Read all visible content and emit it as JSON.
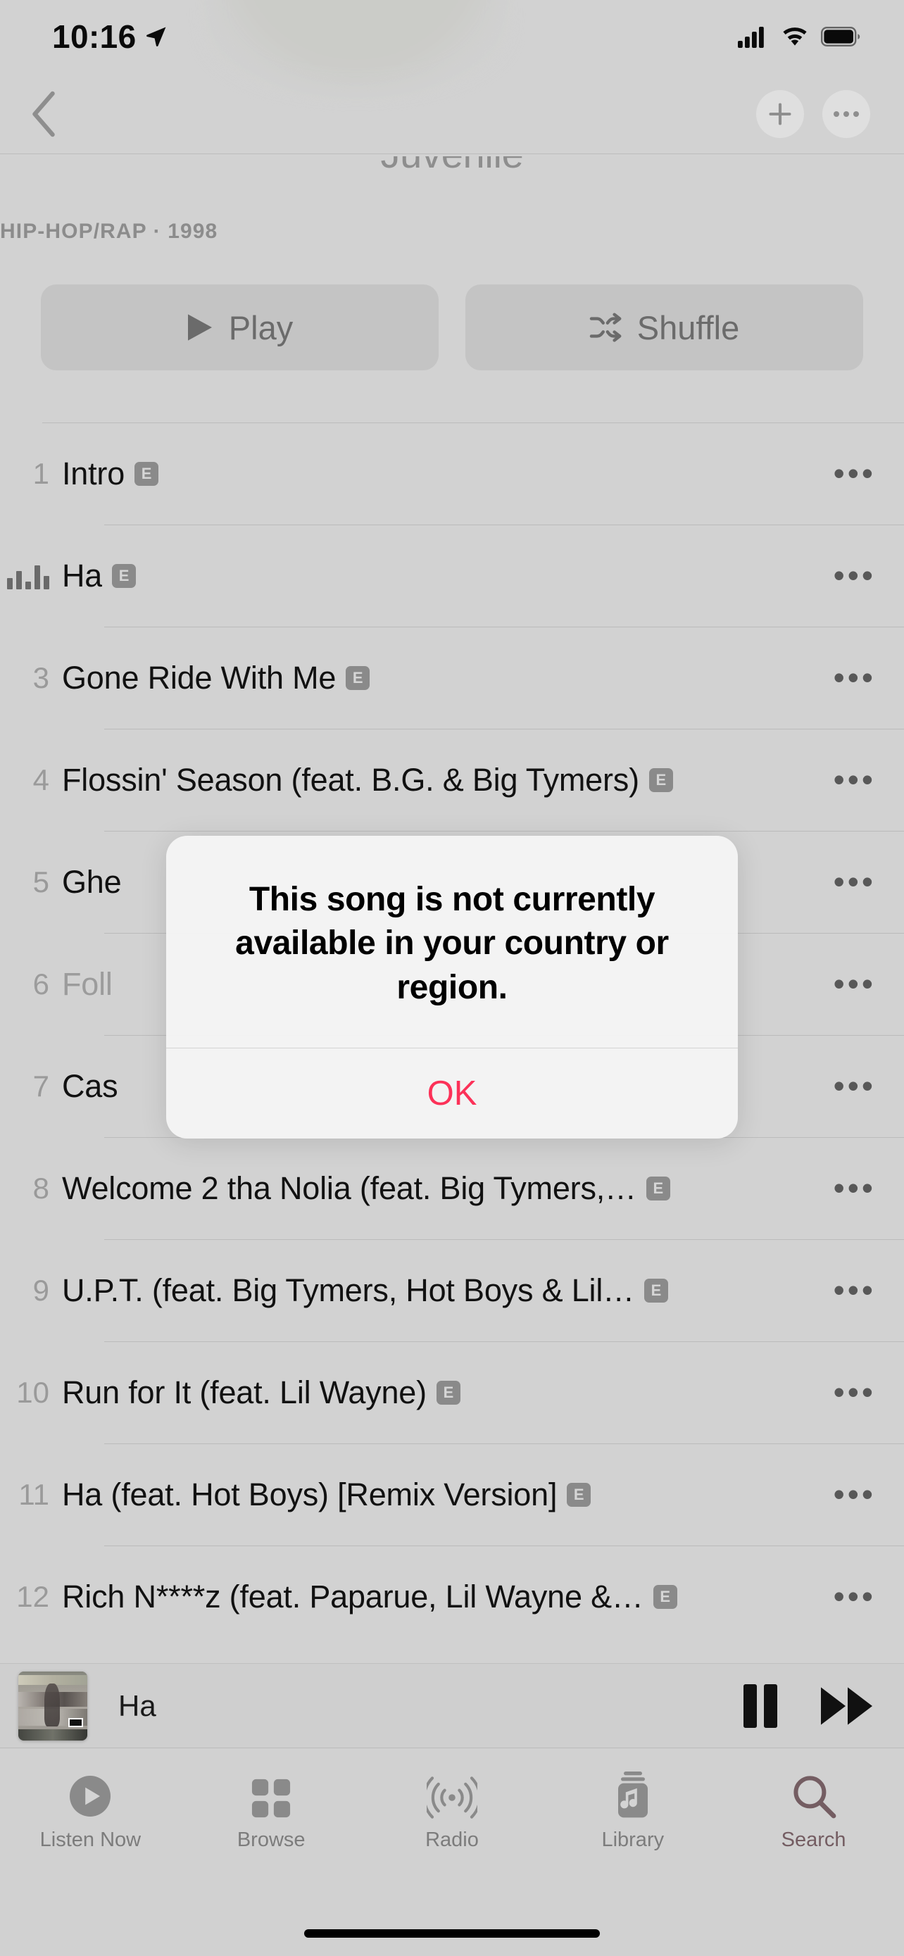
{
  "status_bar": {
    "time": "10:16",
    "location_icon": "location-arrow-icon",
    "cellular_icon": "cellular-signal-icon",
    "wifi_icon": "wifi-icon",
    "battery_icon": "battery-full-icon"
  },
  "nav_bar": {
    "back_icon": "chevron-left-icon",
    "add_icon": "plus-icon",
    "more_icon": "ellipsis-icon"
  },
  "album": {
    "artist": "Juvenile",
    "meta": "HIP-HOP/RAP · 1998",
    "play_label": "Play",
    "play_icon": "play-triangle-icon",
    "shuffle_label": "Shuffle",
    "shuffle_icon": "shuffle-icon"
  },
  "tracks": [
    {
      "num": "1",
      "title": "Intro",
      "explicit": "E",
      "playing": false,
      "dim": false
    },
    {
      "num": "",
      "title": "Ha",
      "explicit": "E",
      "playing": true,
      "dim": false
    },
    {
      "num": "3",
      "title": "Gone Ride With Me",
      "explicit": "E",
      "playing": false,
      "dim": false
    },
    {
      "num": "4",
      "title": "Flossin' Season (feat. B.G. & Big Tymers)",
      "explicit": "E",
      "playing": false,
      "dim": false
    },
    {
      "num": "5",
      "title": "Ghe",
      "explicit": "",
      "playing": false,
      "dim": false
    },
    {
      "num": "6",
      "title": "Foll",
      "explicit": "",
      "playing": false,
      "dim": true
    },
    {
      "num": "7",
      "title": "Cas",
      "explicit": "",
      "playing": false,
      "dim": false
    },
    {
      "num": "8",
      "title": "Welcome 2 tha Nolia (feat. Big Tymers,…",
      "explicit": "E",
      "playing": false,
      "dim": false
    },
    {
      "num": "9",
      "title": "U.P.T. (feat. Big Tymers, Hot Boys & Lil…",
      "explicit": "E",
      "playing": false,
      "dim": false
    },
    {
      "num": "10",
      "title": "Run for It (feat. Lil Wayne)",
      "explicit": "E",
      "playing": false,
      "dim": false
    },
    {
      "num": "11",
      "title": "Ha (feat. Hot Boys) [Remix Version]",
      "explicit": "E",
      "playing": false,
      "dim": false
    },
    {
      "num": "12",
      "title": "Rich N****z (feat. Paparue, Lil Wayne &…",
      "explicit": "E",
      "playing": false,
      "dim": false
    }
  ],
  "track_row_more_icon": "ellipsis-icon",
  "mini_player": {
    "artwork_name": "album-artwork-400-degreez",
    "title": "Ha",
    "pause_icon": "pause-icon",
    "next_icon": "fast-forward-icon"
  },
  "tab_bar": {
    "items": [
      {
        "label": "Listen Now",
        "icon": "play-circle-icon",
        "active": false
      },
      {
        "label": "Browse",
        "icon": "grid-squares-icon",
        "active": false
      },
      {
        "label": "Radio",
        "icon": "radio-waves-icon",
        "active": false
      },
      {
        "label": "Library",
        "icon": "music-library-icon",
        "active": false
      },
      {
        "label": "Search",
        "icon": "magnifier-icon",
        "active": true
      }
    ],
    "active_color": "#f9365e",
    "inactive_color": "#7c7c7c"
  },
  "alert": {
    "message": "This song is not currently available in your country or region.",
    "ok_label": "OK",
    "ok_color": "#fc3158"
  }
}
